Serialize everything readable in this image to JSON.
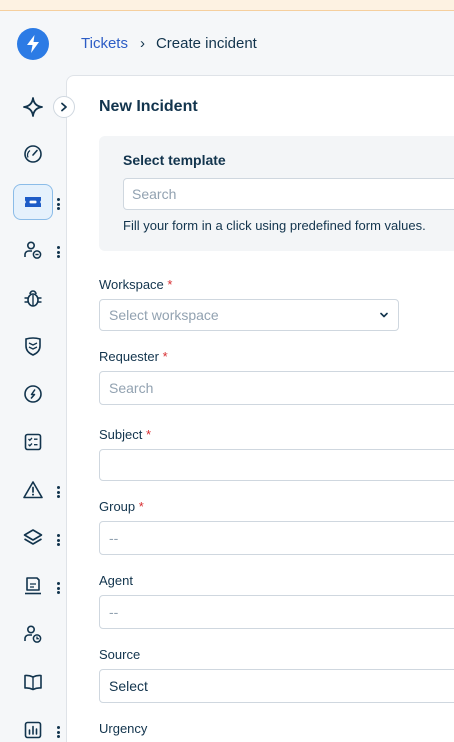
{
  "breadcrumb": {
    "parent": "Tickets",
    "separator": "›",
    "current": "Create incident"
  },
  "page": {
    "title": "New Incident"
  },
  "template": {
    "title": "Select template",
    "search_placeholder": "Search",
    "hint": "Fill your form in a click using predefined form values."
  },
  "form": {
    "required_mark": "*",
    "workspace": {
      "label": "Workspace",
      "placeholder": "Select workspace"
    },
    "requester": {
      "label": "Requester",
      "placeholder": "Search"
    },
    "subject": {
      "label": "Subject",
      "value": ""
    },
    "group": {
      "label": "Group",
      "value": "--"
    },
    "agent": {
      "label": "Agent",
      "value": "--"
    },
    "source": {
      "label": "Source",
      "value": "Select"
    },
    "urgency": {
      "label": "Urgency"
    }
  },
  "sidebar": {
    "items": [
      {
        "icon": "sparkle-icon"
      },
      {
        "icon": "dashboard-gauge-icon"
      },
      {
        "icon": "ticket-icon",
        "active": true
      },
      {
        "icon": "user-changes-icon"
      },
      {
        "icon": "bug-icon"
      },
      {
        "icon": "shield-icon"
      },
      {
        "icon": "compass-icon"
      },
      {
        "icon": "checklist-icon"
      },
      {
        "icon": "alert-triangle-icon"
      },
      {
        "icon": "layers-icon"
      },
      {
        "icon": "user-badge-icon"
      },
      {
        "icon": "user-clock-icon"
      },
      {
        "icon": "book-icon"
      },
      {
        "icon": "analytics-icon"
      }
    ]
  },
  "colors": {
    "accent": "#2c5cc5",
    "brand": "#2c7be5",
    "required": "#d72d30",
    "text": "#12344d"
  }
}
